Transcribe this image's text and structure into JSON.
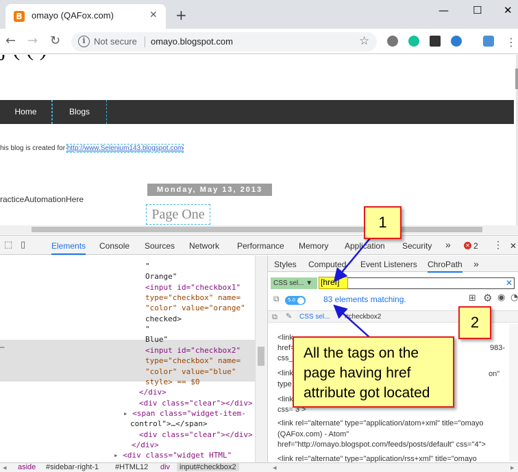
{
  "browser": {
    "tab_title": "omayo (QAFox.com)",
    "tab_close": "✕",
    "new_tab": "+",
    "favicon": "B",
    "window_controls": [
      "—",
      "☐",
      "✕"
    ],
    "not_secure": "Not secure",
    "url": "omayo.blogspot.com",
    "info_icon": "i"
  },
  "page": {
    "nav": [
      "Home",
      "Blogs"
    ],
    "blog_text": "his blog is created for ",
    "blog_link": "http://www.Selenium143.blogspot.com",
    "date": "Monday, May 13, 2013",
    "practice": "racticeAutomationHere",
    "page_one": "Page One"
  },
  "devtools": {
    "tabs": [
      "Elements",
      "Console",
      "Sources",
      "Network",
      "Performance",
      "Memory",
      "Application",
      "Security"
    ],
    "more": "»",
    "error_count": "2",
    "sub_tabs": [
      "Styles",
      "Computed",
      "Event Listeners",
      "ChroPath"
    ],
    "sub_more": "»",
    "close": "✕",
    "menu": "⋮"
  },
  "elements_code": [
    "\"",
    "Orange\"",
    "<input id=\"checkbox1\"",
    "type=\"checkbox\" name=",
    "\"color\" value=\"orange\"",
    "checked>",
    "\"",
    "Blue\"",
    "<input id=\"checkbox2\"",
    "type=\"checkbox\" name=",
    "\"color\" value=\"blue\"",
    "style> == $0",
    "</div>",
    "<div class=\"clear\"></div>",
    "<span class=\"widget-item-",
    "control\">…</span>",
    "<div class=\"clear\"></div>",
    "</div>",
    "<div class=\"widget HTML\""
  ],
  "chropath": {
    "selector_type": "CSS sel...",
    "input_value": "[href]",
    "version": "5.0",
    "match_text": "83 elements matching.",
    "result_selector_type": "CSS sel...",
    "result_selector": "#checkbox2",
    "results": [
      "<link",
      "href=",
      "css_b",
      "<link",
      "type",
      "<link",
      "css= 3 >",
      "<link rel=\"alternate\" type=\"application/atom+xml\" title=\"omayo",
      "(QAFox.com) - Atom\"",
      "href=\"http://omayo.blogspot.com/feeds/posts/default\" css=\"4\">",
      "<link rel=\"alternate\" type=\"application/rss+xml\" title=\"omayo"
    ],
    "results_right": [
      "983-",
      "on\""
    ]
  },
  "breadcrumbs": [
    "aside",
    "#sidebar-right-1",
    "#HTML12",
    "div",
    "input#checkbox2"
  ],
  "callouts": {
    "one": "1",
    "two": "2",
    "text": "All the tags on the page having href attribute got located"
  },
  "colors": {
    "annotation_fill": "#ffff99",
    "annotation_border": "#e31b1b",
    "arrow": "#1a1ad6",
    "selected_tab": "#1a73e8"
  }
}
